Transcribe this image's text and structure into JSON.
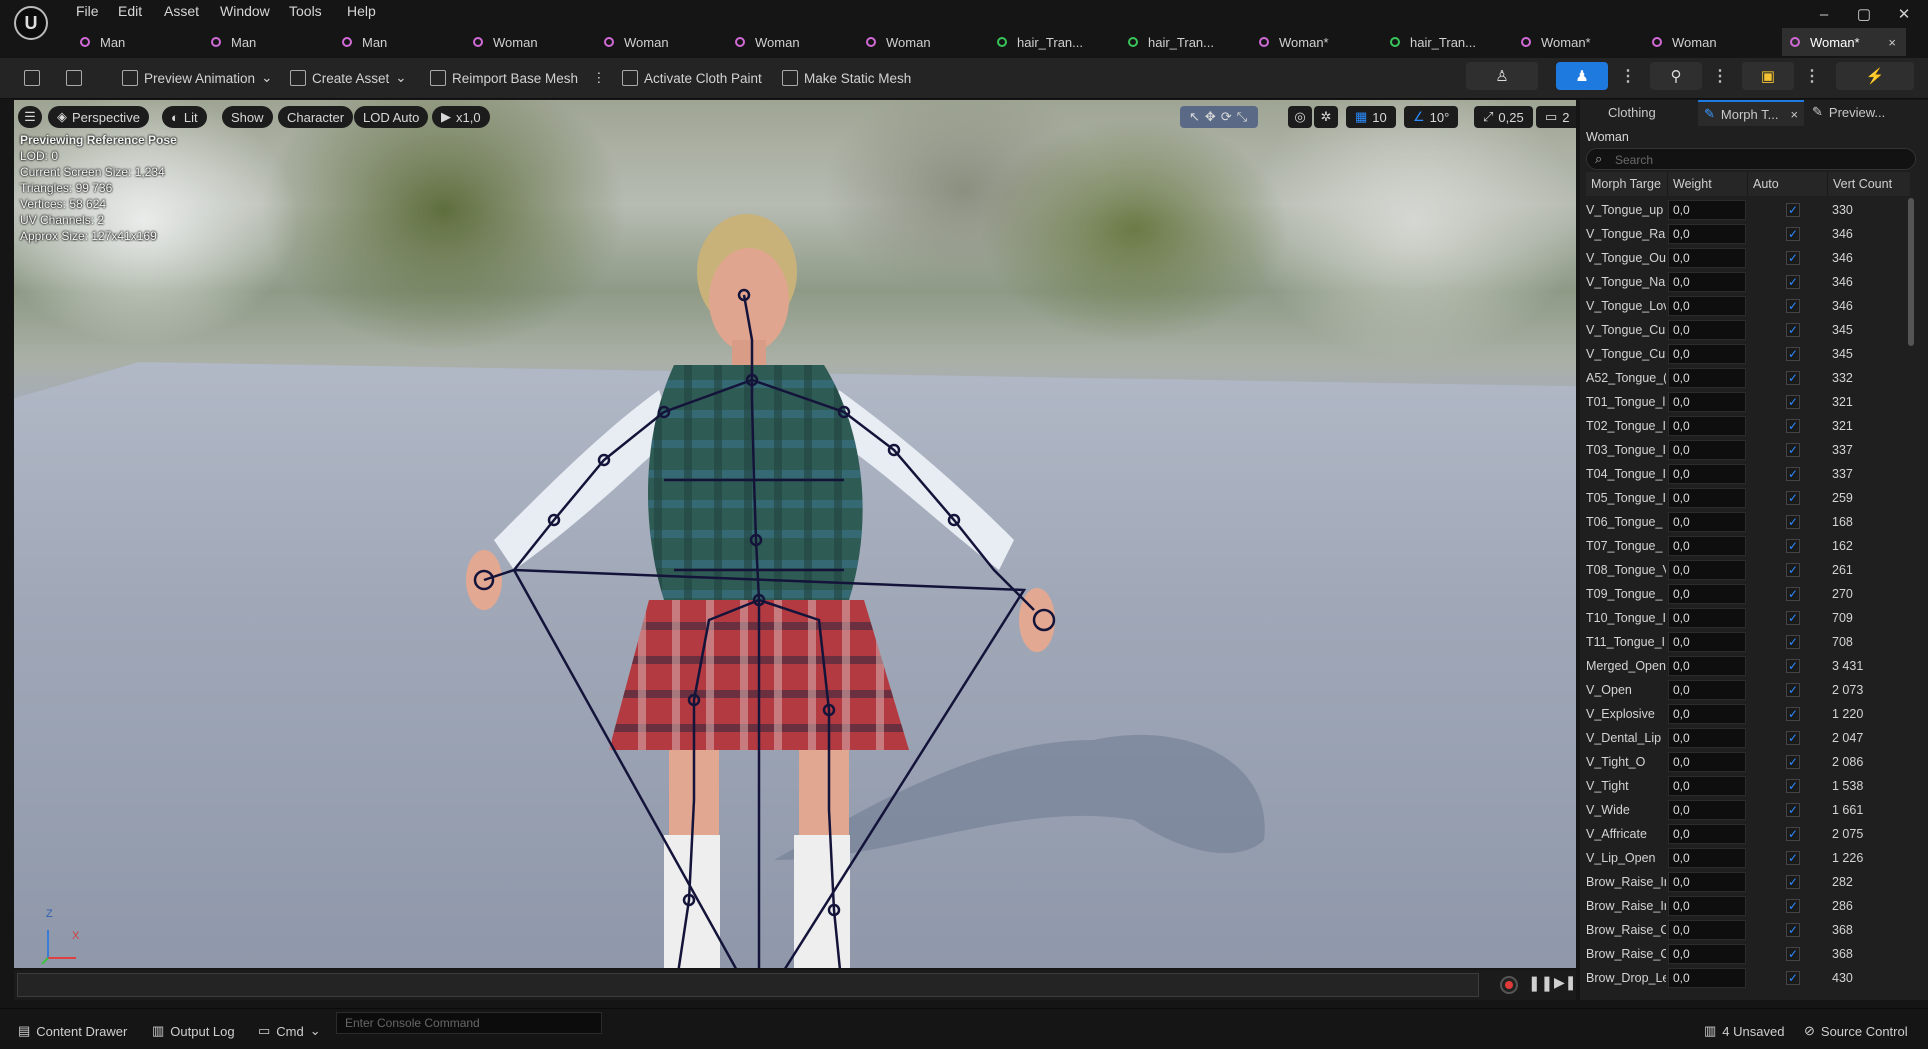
{
  "app": {
    "logo_text": "U"
  },
  "menu": [
    "File",
    "Edit",
    "Asset",
    "Window",
    "Tools",
    "Help"
  ],
  "window_controls": {
    "minimize": "–",
    "maximize": "▢",
    "close": "✕"
  },
  "tabs": [
    {
      "label": "Man",
      "icon": "skeletal-mesh-icon"
    },
    {
      "label": "Man",
      "icon": "skeletal-mesh-icon"
    },
    {
      "label": "Man",
      "icon": "skeletal-mesh-icon"
    },
    {
      "label": "Woman",
      "icon": "skeletal-mesh-icon"
    },
    {
      "label": "Woman",
      "icon": "skeletal-mesh-icon"
    },
    {
      "label": "Woman",
      "icon": "skeletal-mesh-icon"
    },
    {
      "label": "Woman",
      "icon": "skeletal-mesh-icon"
    },
    {
      "label": "hair_Tran...",
      "icon": "groom-icon"
    },
    {
      "label": "hair_Tran...",
      "icon": "groom-icon"
    },
    {
      "label": "Woman*",
      "icon": "skeletal-mesh-icon"
    },
    {
      "label": "hair_Tran...",
      "icon": "groom-icon"
    },
    {
      "label": "Woman*",
      "icon": "skeletal-mesh-icon"
    },
    {
      "label": "Woman",
      "icon": "skeletal-mesh-icon"
    },
    {
      "label": "Woman*",
      "icon": "skeletal-mesh-icon",
      "active": true,
      "close": "×"
    }
  ],
  "toolbar": {
    "preview_animation": "Preview Animation",
    "create_asset": "Create Asset",
    "reimport_base_mesh": "Reimport Base Mesh",
    "activate_cloth_paint": "Activate Cloth Paint",
    "make_static_mesh": "Make Static Mesh"
  },
  "viewport": {
    "perspective": "Perspective",
    "lit": "Lit",
    "show": "Show",
    "character": "Character",
    "lod": "LOD Auto",
    "play_rate": "x1,0",
    "grid_snap": "10",
    "rotation_snap": "10°",
    "scale_snap": "0,25",
    "camera_speed": "2",
    "stats": {
      "title": "Previewing Reference Pose",
      "lod": "LOD: 0",
      "screen_size": "Current Screen Size: 1,234",
      "triangles": "Triangles: 99 736",
      "vertices": "Vertices: 58 624",
      "uv_channels": "UV Channels: 2",
      "approx_size": "Approx Size: 127x41x169"
    },
    "axis_z": "Z",
    "axis_x": "X"
  },
  "panel": {
    "tabs": [
      "Clothing",
      "Morph T...",
      "Preview..."
    ],
    "close": "×",
    "owner": "Woman",
    "search_placeholder": "Search",
    "columns": [
      "Morph Targe",
      "Weight",
      "Auto",
      "Vert Count"
    ],
    "rows": [
      {
        "name": "V_Tongue_up",
        "weight": "0,0",
        "auto": true,
        "verts": "330"
      },
      {
        "name": "V_Tongue_Rai",
        "weight": "0,0",
        "auto": true,
        "verts": "346"
      },
      {
        "name": "V_Tongue_Ou",
        "weight": "0,0",
        "auto": true,
        "verts": "346"
      },
      {
        "name": "V_Tongue_Na",
        "weight": "0,0",
        "auto": true,
        "verts": "346"
      },
      {
        "name": "V_Tongue_Lov",
        "weight": "0,0",
        "auto": true,
        "verts": "346"
      },
      {
        "name": "V_Tongue_Cur",
        "weight": "0,0",
        "auto": true,
        "verts": "345"
      },
      {
        "name": "V_Tongue_Cur",
        "weight": "0,0",
        "auto": true,
        "verts": "345"
      },
      {
        "name": "A52_Tongue_(",
        "weight": "0,0",
        "auto": true,
        "verts": "332"
      },
      {
        "name": "T01_Tongue_l",
        "weight": "0,0",
        "auto": true,
        "verts": "321"
      },
      {
        "name": "T02_Tongue_I",
        "weight": "0,0",
        "auto": true,
        "verts": "321"
      },
      {
        "name": "T03_Tongue_I",
        "weight": "0,0",
        "auto": true,
        "verts": "337"
      },
      {
        "name": "T04_Tongue_I",
        "weight": "0,0",
        "auto": true,
        "verts": "337"
      },
      {
        "name": "T05_Tongue_I",
        "weight": "0,0",
        "auto": true,
        "verts": "259"
      },
      {
        "name": "T06_Tongue_",
        "weight": "0,0",
        "auto": true,
        "verts": "168"
      },
      {
        "name": "T07_Tongue_",
        "weight": "0,0",
        "auto": true,
        "verts": "162"
      },
      {
        "name": "T08_Tongue_V",
        "weight": "0,0",
        "auto": true,
        "verts": "261"
      },
      {
        "name": "T09_Tongue_",
        "weight": "0,0",
        "auto": true,
        "verts": "270"
      },
      {
        "name": "T10_Tongue_I",
        "weight": "0,0",
        "auto": true,
        "verts": "709"
      },
      {
        "name": "T11_Tongue_I",
        "weight": "0,0",
        "auto": true,
        "verts": "708"
      },
      {
        "name": "Merged_Open",
        "weight": "0,0",
        "auto": true,
        "verts": "3 431"
      },
      {
        "name": "V_Open",
        "weight": "0,0",
        "auto": true,
        "verts": "2 073"
      },
      {
        "name": "V_Explosive",
        "weight": "0,0",
        "auto": true,
        "verts": "1 220"
      },
      {
        "name": "V_Dental_Lip",
        "weight": "0,0",
        "auto": true,
        "verts": "2 047"
      },
      {
        "name": "V_Tight_O",
        "weight": "0,0",
        "auto": true,
        "verts": "2 086"
      },
      {
        "name": "V_Tight",
        "weight": "0,0",
        "auto": true,
        "verts": "1 538"
      },
      {
        "name": "V_Wide",
        "weight": "0,0",
        "auto": true,
        "verts": "1 661"
      },
      {
        "name": "V_Affricate",
        "weight": "0,0",
        "auto": true,
        "verts": "2 075"
      },
      {
        "name": "V_Lip_Open",
        "weight": "0,0",
        "auto": true,
        "verts": "1 226"
      },
      {
        "name": "Brow_Raise_Ir",
        "weight": "0,0",
        "auto": true,
        "verts": "282"
      },
      {
        "name": "Brow_Raise_Ir",
        "weight": "0,0",
        "auto": true,
        "verts": "286"
      },
      {
        "name": "Brow_Raise_C",
        "weight": "0,0",
        "auto": true,
        "verts": "368"
      },
      {
        "name": "Brow_Raise_C",
        "weight": "0,0",
        "auto": true,
        "verts": "368"
      },
      {
        "name": "Brow_Drop_Le",
        "weight": "0,0",
        "auto": true,
        "verts": "430"
      }
    ]
  },
  "status": {
    "content_drawer": "Content Drawer",
    "output_log": "Output Log",
    "cmd": "Cmd",
    "console_placeholder": "Enter Console Command",
    "unsaved": "4 Unsaved",
    "source_control": "Source Control"
  },
  "colors": {
    "accent_blue": "#1f7ae0",
    "checkbox": "#2a8cff",
    "skeleton": "#14143a"
  }
}
